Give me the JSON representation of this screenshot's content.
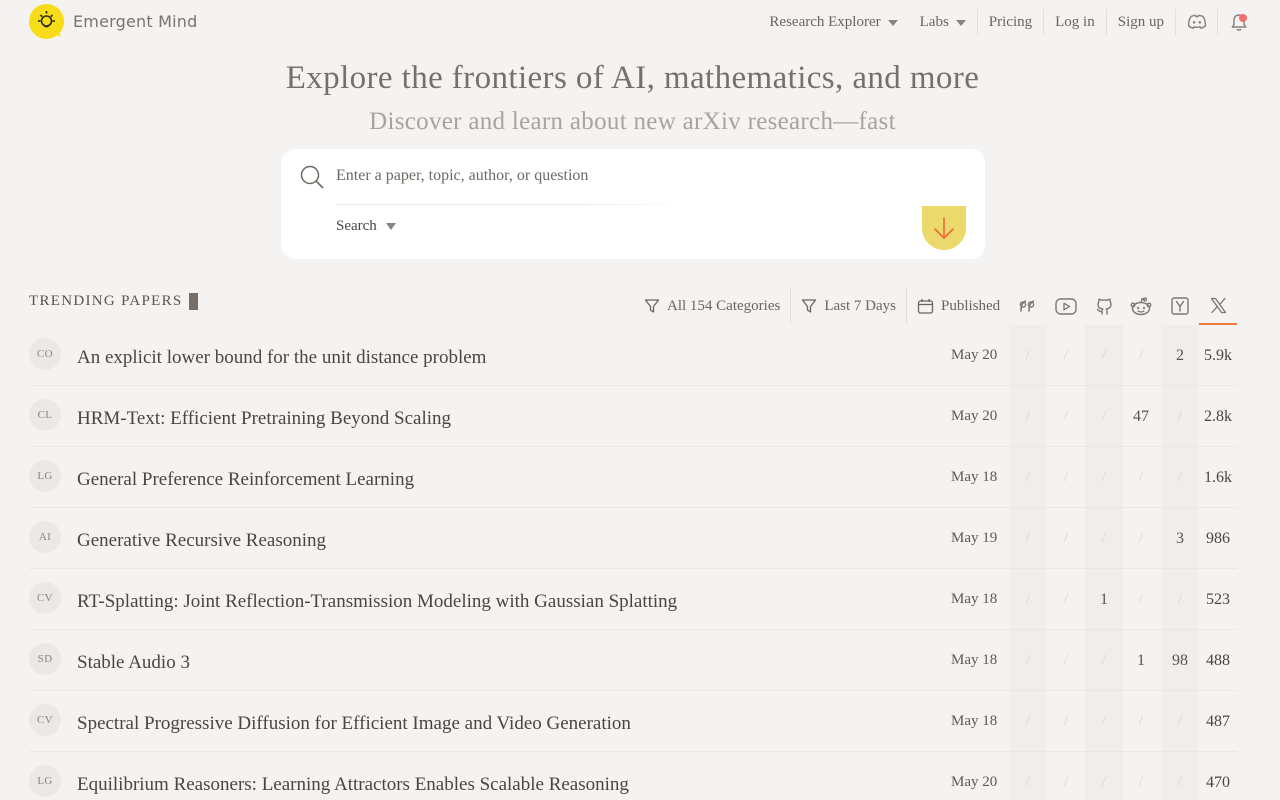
{
  "brand": {
    "name": "Emergent Mind"
  },
  "nav": {
    "research_explorer": "Research Explorer",
    "labs": "Labs",
    "pricing": "Pricing",
    "login": "Log in",
    "signup": "Sign up"
  },
  "hero": {
    "title": "Explore the frontiers of AI, mathematics, and more",
    "subtitle": "Discover and learn about new arXiv research—fast"
  },
  "search": {
    "placeholder": "Enter a paper, topic, author, or question",
    "mode": "Search"
  },
  "trending": {
    "label": "TRENDING PAPERS",
    "filters": {
      "categories": "All 154 Categories",
      "period": "Last 7 Days",
      "sort": "Published"
    },
    "metric_icons": [
      "quote-icon",
      "youtube-icon",
      "github-icon",
      "reddit-icon",
      "hackernews-icon",
      "x-icon"
    ],
    "slash": "/",
    "papers": [
      {
        "cat": "CO",
        "title": "An explicit lower bound for the unit distance problem",
        "date": "May 20",
        "m": [
          "/",
          "/",
          "/",
          "/",
          "2",
          "5.9k"
        ]
      },
      {
        "cat": "CL",
        "title": "HRM-Text: Efficient Pretraining Beyond Scaling",
        "date": "May 20",
        "m": [
          "/",
          "/",
          "/",
          "47",
          "/",
          "2.8k"
        ]
      },
      {
        "cat": "LG",
        "title": "General Preference Reinforcement Learning",
        "date": "May 18",
        "m": [
          "/",
          "/",
          "/",
          "/",
          "/",
          "1.6k"
        ]
      },
      {
        "cat": "AI",
        "title": "Generative Recursive Reasoning",
        "date": "May 19",
        "m": [
          "/",
          "/",
          "/",
          "/",
          "3",
          "986"
        ]
      },
      {
        "cat": "CV",
        "title": "RT-Splatting: Joint Reflection-Transmission Modeling with Gaussian Splatting",
        "date": "May 18",
        "m": [
          "/",
          "/",
          "1",
          "/",
          "/",
          "523"
        ]
      },
      {
        "cat": "SD",
        "title": "Stable Audio 3",
        "date": "May 18",
        "m": [
          "/",
          "/",
          "/",
          "1",
          "98",
          "488"
        ]
      },
      {
        "cat": "CV",
        "title": "Spectral Progressive Diffusion for Efficient Image and Video Generation",
        "date": "May 18",
        "m": [
          "/",
          "/",
          "/",
          "/",
          "/",
          "487"
        ]
      },
      {
        "cat": "LG",
        "title": "Equilibrium Reasoners: Learning Attractors Enables Scalable Reasoning",
        "date": "May 20",
        "m": [
          "/",
          "/",
          "/",
          "/",
          "/",
          "470"
        ]
      }
    ]
  }
}
